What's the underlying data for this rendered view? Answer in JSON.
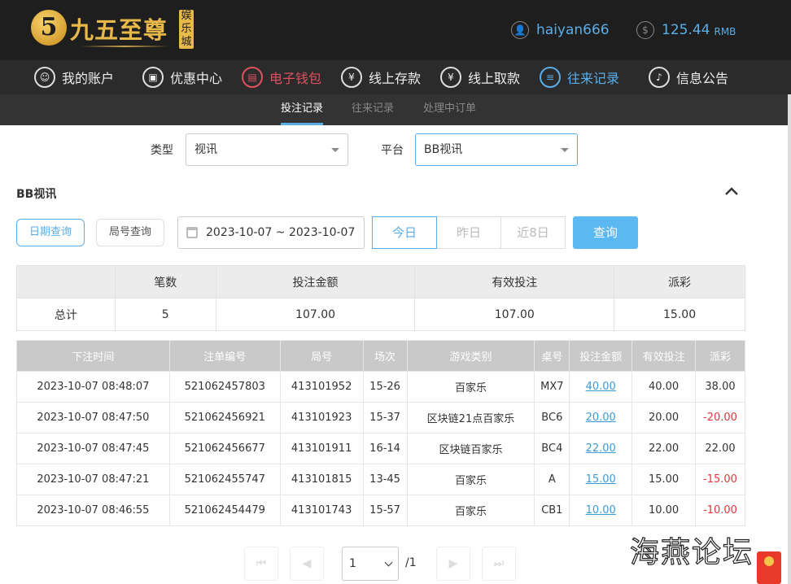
{
  "header": {
    "logo_mark": "5",
    "logo_text": "九五至尊",
    "logo_badge": "娱乐城",
    "username": "haiyan666",
    "balance": "125.44",
    "currency": "RMB"
  },
  "nav": [
    {
      "label": "我的账户",
      "icon": "user-icon"
    },
    {
      "label": "优惠中心",
      "icon": "gift-icon"
    },
    {
      "label": "电子钱包",
      "icon": "wallet-icon"
    },
    {
      "label": "线上存款",
      "icon": "deposit-icon"
    },
    {
      "label": "线上取款",
      "icon": "withdraw-icon"
    },
    {
      "label": "往来记录",
      "icon": "records-icon"
    },
    {
      "label": "信息公告",
      "icon": "bell-icon"
    }
  ],
  "subnav": [
    "投注记录",
    "往来记录",
    "处理中订单"
  ],
  "filters": {
    "type_label": "类型",
    "type_value": "视讯",
    "platform_label": "平台",
    "platform_value": "BB视讯"
  },
  "section_title": "BB视讯",
  "query": {
    "date_query": "日期查询",
    "round_query": "局号查询",
    "date_range": "2023-10-07 ~ 2023-10-07",
    "today": "今日",
    "yesterday": "昨日",
    "last8": "近8日",
    "search": "查询"
  },
  "summary": {
    "headers": [
      "",
      "笔数",
      "投注金额",
      "有效投注",
      "派彩"
    ],
    "row": [
      "总计",
      "5",
      "107.00",
      "107.00",
      "15.00"
    ]
  },
  "details": {
    "headers": [
      "下注时间",
      "注单编号",
      "局号",
      "场次",
      "游戏类别",
      "桌号",
      "投注金额",
      "有效投注",
      "派彩"
    ],
    "rows": [
      [
        "2023-10-07 08:48:07",
        "521062457803",
        "413101952",
        "15-26",
        "百家乐",
        "MX7",
        "40.00",
        "40.00",
        "38.00"
      ],
      [
        "2023-10-07 08:47:50",
        "521062456921",
        "413101923",
        "15-37",
        "区块链21点百家乐",
        "BC6",
        "20.00",
        "20.00",
        "-20.00"
      ],
      [
        "2023-10-07 08:47:45",
        "521062456677",
        "413101911",
        "16-14",
        "区块链百家乐",
        "BC4",
        "22.00",
        "22.00",
        "22.00"
      ],
      [
        "2023-10-07 08:47:21",
        "521062455747",
        "413101815",
        "13-45",
        "百家乐",
        "A",
        "15.00",
        "15.00",
        "-15.00"
      ],
      [
        "2023-10-07 08:46:55",
        "521062454479",
        "413101743",
        "15-57",
        "百家乐",
        "CB1",
        "10.00",
        "10.00",
        "-10.00"
      ]
    ]
  },
  "pager": {
    "first": "⏮",
    "prev": "◀",
    "page": "1",
    "total": "/1",
    "next": "▶",
    "last": "⏭"
  },
  "watermark": "海燕论坛",
  "colors": {
    "accent": "#5aaee8",
    "danger": "#e8343a",
    "active_nav": "#e0505e"
  }
}
